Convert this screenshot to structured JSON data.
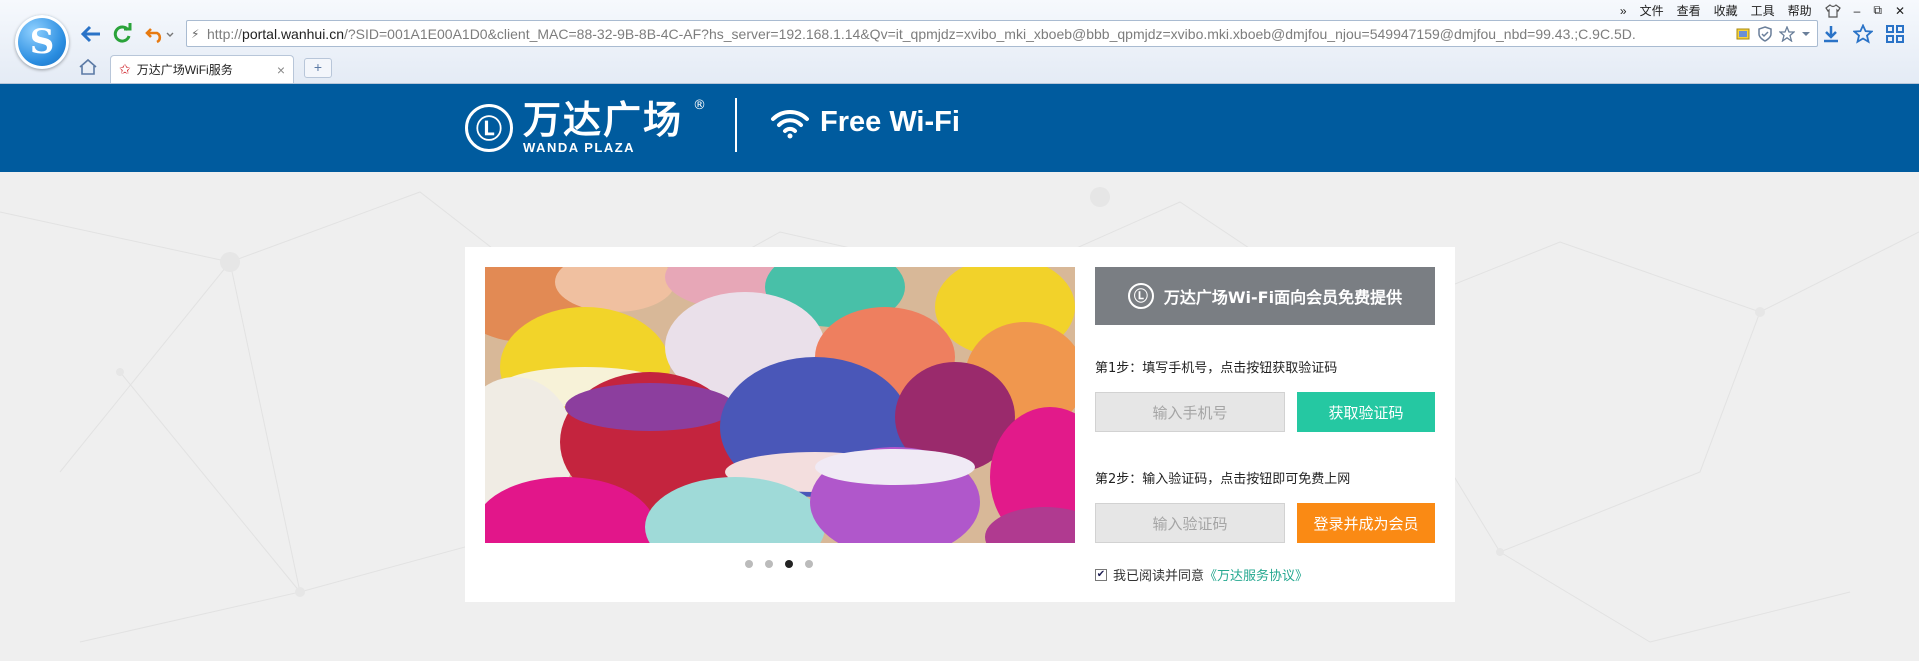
{
  "browser": {
    "logo_letter": "S",
    "address_prefix": "http://",
    "address_domain": "portal.wanhui.cn",
    "address_rest": "/?SID=001A1E00A1D0&client_MAC=88-32-9B-8B-4C-AF?hs_server=192.168.1.14&Qv=it_qpmjdz=xvibo_mki_xboeb@bbb_qpmjdz=xvibo.mki.xboeb@dmjfou_njou=549947159@dmjfou_nbd=99.43.;C.9C.5D.",
    "menu": [
      "文件",
      "查看",
      "收藏",
      "工具",
      "帮助"
    ],
    "menu_more": "»",
    "tab_title": "万达广场WiFi服务",
    "tab_close": "×",
    "new_tab": "+"
  },
  "header": {
    "brand_cn": "万达广场",
    "brand_en": "WANDA PLAZA",
    "registered_mark": "®",
    "wifi_text": "Free Wi-Fi"
  },
  "form": {
    "notice": "万达广场Wi-Fi面向会员免费提供",
    "step1": "第1步：填写手机号，点击按钮获取验证码",
    "phone_placeholder": "输入手机号",
    "get_code_button": "获取验证码",
    "step2": "第2步：输入验证码，点击按钮即可免费上网",
    "code_placeholder": "输入验证码",
    "login_button": "登录并成为会员",
    "agree_prefix": "我已阅读并同意",
    "agree_link": "《万达服务协议》",
    "agreed": true
  },
  "carousel": {
    "slides": 4,
    "active_index": 2
  },
  "colors": {
    "header_blue": "#005b9e",
    "teal": "#25c8a2",
    "orange": "#fa8a14",
    "notice_gray": "#7a7e83"
  }
}
